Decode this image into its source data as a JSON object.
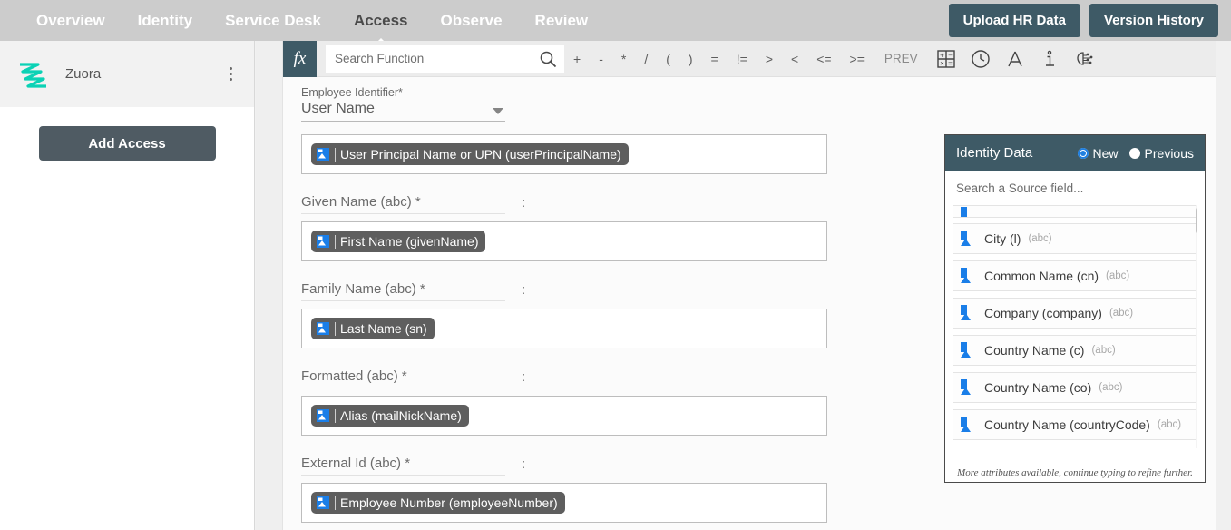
{
  "topnav": {
    "items": [
      {
        "label": "Overview",
        "active": false
      },
      {
        "label": "Identity",
        "active": false
      },
      {
        "label": "Service Desk",
        "active": false
      },
      {
        "label": "Access",
        "active": true
      },
      {
        "label": "Observe",
        "active": false
      },
      {
        "label": "Review",
        "active": false
      }
    ],
    "upload_button": "Upload HR Data",
    "version_button": "Version History",
    "bg_color": "#cccccc",
    "button_color": "#3e5a66"
  },
  "sidebar": {
    "app_name": "Zuora",
    "app_logo_icon": "zuora-logo-icon",
    "menu_icon": "kebab-menu-icon",
    "add_access_button": "Add Access",
    "logo_color": "#0bd2b5"
  },
  "toolbar": {
    "fx_label": "fx",
    "search_placeholder": "Search Function",
    "search_value": "",
    "search_icon": "search-icon",
    "operators": [
      "+",
      "-",
      "*",
      "/",
      "(",
      ")",
      "=",
      "!=",
      ">",
      "<",
      "<=",
      ">="
    ],
    "prev_label": "PREV",
    "icons": [
      {
        "name": "calculator-icon"
      },
      {
        "name": "clock-icon"
      },
      {
        "name": "text-format-icon"
      },
      {
        "name": "info-icon"
      },
      {
        "name": "ai-brain-icon"
      }
    ]
  },
  "form": {
    "identifier_label": "Employee Identifier*",
    "identifier_value": "User Name",
    "fields": [
      {
        "label": null,
        "colon": null,
        "chip": "User Principal Name or UPN (userPrincipalName)",
        "chip_icon": "source-field-icon"
      },
      {
        "label": "Given Name (abc) *",
        "colon": ":",
        "chip": "First Name (givenName)",
        "chip_icon": "source-field-icon"
      },
      {
        "label": "Family Name (abc) *",
        "colon": ":",
        "chip": "Last Name (sn)",
        "chip_icon": "source-field-icon"
      },
      {
        "label": "Formatted (abc) *",
        "colon": ":",
        "chip": "Alias (mailNickName)",
        "chip_icon": "source-field-icon"
      },
      {
        "label": "External Id (abc) *",
        "colon": ":",
        "chip": "Employee Number (employeeNumber)",
        "chip_icon": "source-field-icon"
      }
    ]
  },
  "identity_panel": {
    "title": "Identity Data",
    "options": [
      {
        "label": "New",
        "selected": true
      },
      {
        "label": "Previous",
        "selected": false
      }
    ],
    "search_placeholder": "Search a Source field...",
    "search_value": "",
    "items": [
      {
        "name": "",
        "type": "",
        "clipped": true
      },
      {
        "name": "City (l)",
        "type": "(abc)"
      },
      {
        "name": "Common Name (cn)",
        "type": "(abc)"
      },
      {
        "name": "Company (company)",
        "type": "(abc)"
      },
      {
        "name": "Country Name (c)",
        "type": "(abc)"
      },
      {
        "name": "Country Name (co)",
        "type": "(abc)"
      },
      {
        "name": "Country Name (countryCode)",
        "type": "(abc)"
      }
    ],
    "footer": "More attributes available, continue typing to refine further.",
    "header_color": "#3e5a66",
    "radio_color": "#1f7fe0"
  }
}
